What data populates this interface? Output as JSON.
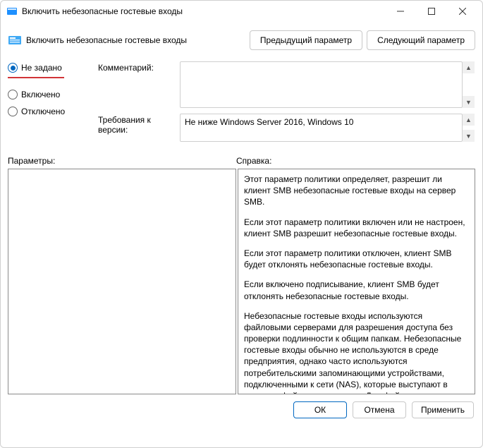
{
  "window": {
    "title": "Включить небезопасные гостевые входы"
  },
  "header": {
    "policy_name": "Включить небезопасные гостевые входы",
    "prev_button": "Предыдущий параметр",
    "next_button": "Следующий параметр"
  },
  "state_radios": {
    "not_configured": "Не задано",
    "enabled": "Включено",
    "disabled": "Отключено",
    "selected": "not_configured"
  },
  "labels": {
    "comment": "Комментарий:",
    "requirements": "Требования к версии:",
    "options_heading": "Параметры:",
    "help_heading": "Справка:"
  },
  "fields": {
    "comment_value": "",
    "requirements_text": "Не ниже Windows Server 2016, Windows 10"
  },
  "help_paragraphs": [
    "Этот параметр политики определяет, разрешит ли клиент SMB небезопасные гостевые входы на сервер SMB.",
    "Если этот параметр политики включен или не настроен, клиент SMB разрешит небезопасные гостевые входы.",
    "Если этот параметр политики отключен, клиент SMB будет отклонять небезопасные гостевые входы.",
    "Если включено подписывание, клиент SMB будет отклонять небезопасные гостевые входы.",
    "Небезопасные гостевые входы используются файловыми серверами для разрешения доступа без проверки подлинности к общим папкам. Небезопасные гостевые входы обычно не используются в среде предприятия, однако часто используются потребительскими запоминающими устройствами, подключенными к сети (NAS), которые выступают в качестве файловых серверов. Для файловых серверов Windows требуется проверка подлинности, и на них по умолчанию не используются небезопасные гостевые"
  ],
  "footer": {
    "ok": "ОК",
    "cancel": "Отмена",
    "apply": "Применить"
  }
}
